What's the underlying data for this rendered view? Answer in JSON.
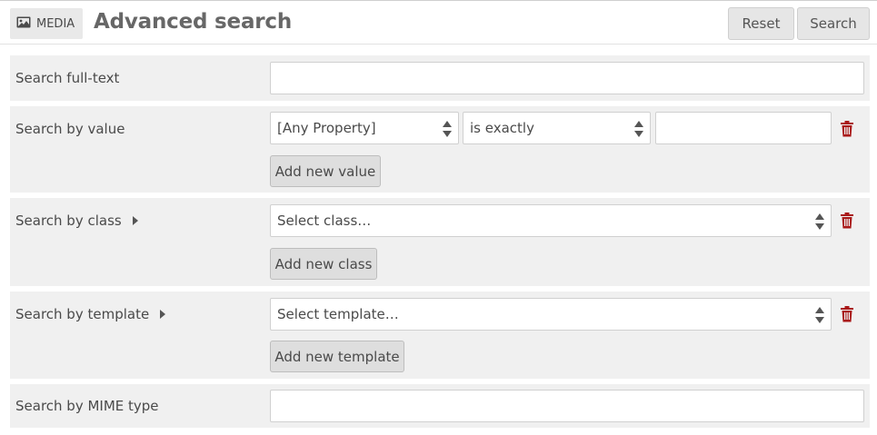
{
  "header": {
    "resource_type": "MEDIA",
    "title": "Advanced search",
    "reset_label": "Reset",
    "search_label": "Search"
  },
  "fulltext": {
    "label": "Search full-text",
    "value": ""
  },
  "value": {
    "label": "Search by value",
    "property_selected": "[Any Property]",
    "operator_selected": "is exactly",
    "text_value": "",
    "add_label": "Add new value"
  },
  "class": {
    "label": "Search by class",
    "selected": "Select class…",
    "add_label": "Add new class"
  },
  "template": {
    "label": "Search by template",
    "selected": "Select template…",
    "add_label": "Add new template"
  },
  "mime": {
    "label": "Search by MIME type",
    "value": ""
  },
  "colors": {
    "delete_red": "#a91919",
    "row_bg": "#f0f0f0"
  }
}
